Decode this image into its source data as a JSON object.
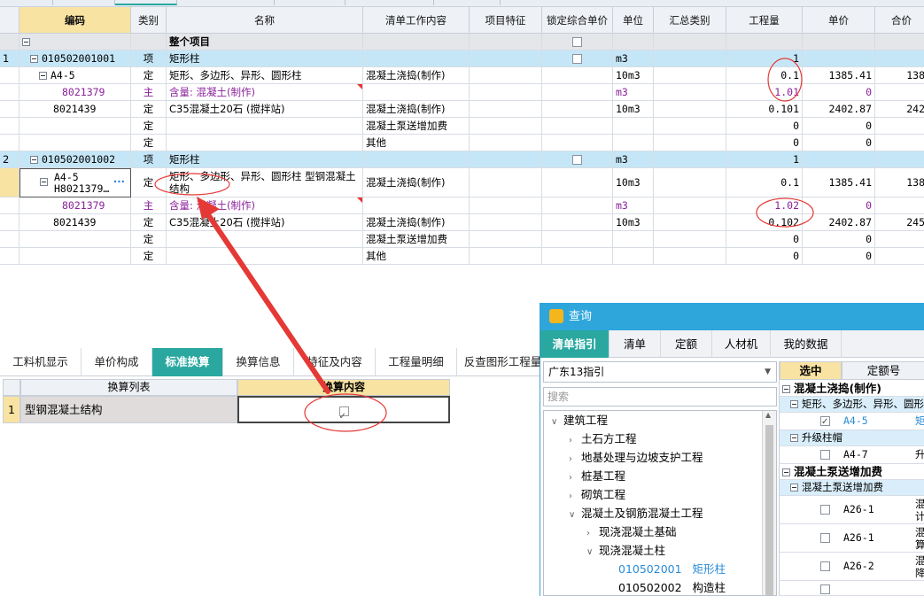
{
  "main_table": {
    "headers": [
      "编码",
      "类别",
      "名称",
      "清单工作内容",
      "项目特征",
      "锁定综合单价",
      "单位",
      "汇总类别",
      "工程量",
      "单价",
      "合价"
    ],
    "summary_row": {
      "name": "整个项目"
    },
    "rows": [
      {
        "num": "1",
        "code": "010502001001",
        "type": "项",
        "name": "矩形柱",
        "content": "",
        "unit": "m3",
        "qty": "1",
        "price": "",
        "total": ""
      },
      {
        "num": "",
        "code": "A4-5",
        "type": "定",
        "name": "矩形、多边形、异形、圆形柱",
        "content": "混凝土浇捣(制作)",
        "unit": "10m3",
        "qty": "0.1",
        "price": "1385.41",
        "total": "138"
      },
      {
        "num": "",
        "code": "8021379",
        "type": "主",
        "name": "含量: 混凝土(制作)",
        "content": "",
        "unit": "m3",
        "qty": "1.01",
        "price": "0",
        "total": ""
      },
      {
        "num": "",
        "code": "8021439",
        "type": "定",
        "name": "C35混凝土20石 (搅拌站)",
        "content": "混凝土浇捣(制作)",
        "unit": "10m3",
        "qty": "0.101",
        "price": "2402.87",
        "total": "242"
      },
      {
        "num": "",
        "code": "",
        "type": "定",
        "name": "",
        "content": "混凝土泵送增加费",
        "unit": "",
        "qty": "0",
        "price": "0",
        "total": ""
      },
      {
        "num": "",
        "code": "",
        "type": "定",
        "name": "",
        "content": "其他",
        "unit": "",
        "qty": "0",
        "price": "0",
        "total": ""
      },
      {
        "num": "2",
        "code": "010502001002",
        "type": "项",
        "name": "矩形柱",
        "content": "",
        "unit": "m3",
        "qty": "1",
        "price": "",
        "total": ""
      },
      {
        "num": "",
        "code": "A4-5",
        "code2": "H8021379…",
        "type": "定",
        "name": "矩形、多边形、异形、圆形柱  型钢混凝土结构",
        "content": "混凝土浇捣(制作)",
        "unit": "10m3",
        "qty": "0.1",
        "price": "1385.41",
        "total": "138"
      },
      {
        "num": "",
        "code": "8021379",
        "type": "主",
        "name": "含量: 混凝土(制作)",
        "content": "",
        "unit": "m3",
        "qty": "1.02",
        "price": "0",
        "total": ""
      },
      {
        "num": "",
        "code": "8021439",
        "type": "定",
        "name": "C35混凝土20石 (搅拌站)",
        "content": "混凝土浇捣(制作)",
        "unit": "10m3",
        "qty": "0.102",
        "price": "2402.87",
        "total": "245"
      },
      {
        "num": "",
        "code": "",
        "type": "定",
        "name": "",
        "content": "混凝土泵送增加费",
        "unit": "",
        "qty": "0",
        "price": "0",
        "total": ""
      },
      {
        "num": "",
        "code": "",
        "type": "定",
        "name": "",
        "content": "其他",
        "unit": "",
        "qty": "0",
        "price": "0",
        "total": ""
      }
    ],
    "ellipsis": "···"
  },
  "bottom_tabs": [
    "工料机显示",
    "单价构成",
    "标准换算",
    "换算信息",
    "特征及内容",
    "工程量明细",
    "反查图形工程量"
  ],
  "conversion": {
    "headers": [
      "换算列表",
      "换算内容"
    ],
    "row_num": "1",
    "item": "型钢混凝土结构"
  },
  "query_window": {
    "title": "查询",
    "tabs": [
      "清单指引",
      "清单",
      "定额",
      "人材机",
      "我的数据"
    ],
    "selector": "广东13指引",
    "search_placeholder": "搜索",
    "tree": [
      {
        "label": "建筑工程",
        "level": 0,
        "state": "open"
      },
      {
        "label": "土石方工程",
        "level": 1,
        "state": "closed"
      },
      {
        "label": "地基处理与边坡支护工程",
        "level": 1,
        "state": "closed"
      },
      {
        "label": "桩基工程",
        "level": 1,
        "state": "closed"
      },
      {
        "label": "砌筑工程",
        "level": 1,
        "state": "closed"
      },
      {
        "label": "混凝土及钢筋混凝土工程",
        "level": 1,
        "state": "open"
      },
      {
        "label": "现浇混凝土基础",
        "level": 2,
        "state": "closed"
      },
      {
        "label": "现浇混凝土柱",
        "level": 2,
        "state": "open"
      },
      {
        "label": "010502001   矩形柱",
        "level": 3,
        "state": "leaf",
        "link": true
      },
      {
        "label": "010502002   构造柱",
        "level": 3,
        "state": "leaf",
        "link": false
      }
    ],
    "right_headers": [
      "选中",
      "定额号"
    ],
    "right_rows": [
      {
        "kind": "group",
        "label": "混凝土浇捣(制作)"
      },
      {
        "kind": "sub",
        "label": "矩形、多边形、异形、圆形"
      },
      {
        "kind": "item",
        "code": "A4-5",
        "checked": true,
        "extra": "矩"
      },
      {
        "kind": "sub",
        "label": "升级柱帽"
      },
      {
        "kind": "item",
        "code": "A4-7",
        "checked": false,
        "extra": "升"
      },
      {
        "kind": "group",
        "label": "混凝土泵送增加费"
      },
      {
        "kind": "sub",
        "label": "混凝土泵送增加费"
      },
      {
        "kind": "item",
        "code": "A26-1",
        "checked": false,
        "extra": "混计"
      },
      {
        "kind": "item",
        "code": "A26-1",
        "checked": false,
        "extra": "混算"
      },
      {
        "kind": "item",
        "code": "A26-2",
        "checked": false,
        "extra": "混降"
      },
      {
        "kind": "item",
        "code": "",
        "checked": false,
        "extra": ""
      }
    ]
  },
  "colors": {
    "accent": "#2aa8a0",
    "title_bar": "#2ea6dc",
    "item_row": "#c5e6f7",
    "header_selected": "#f8e3a2",
    "annotation": "#e53935",
    "main_material_text": "#8a1f9a"
  }
}
